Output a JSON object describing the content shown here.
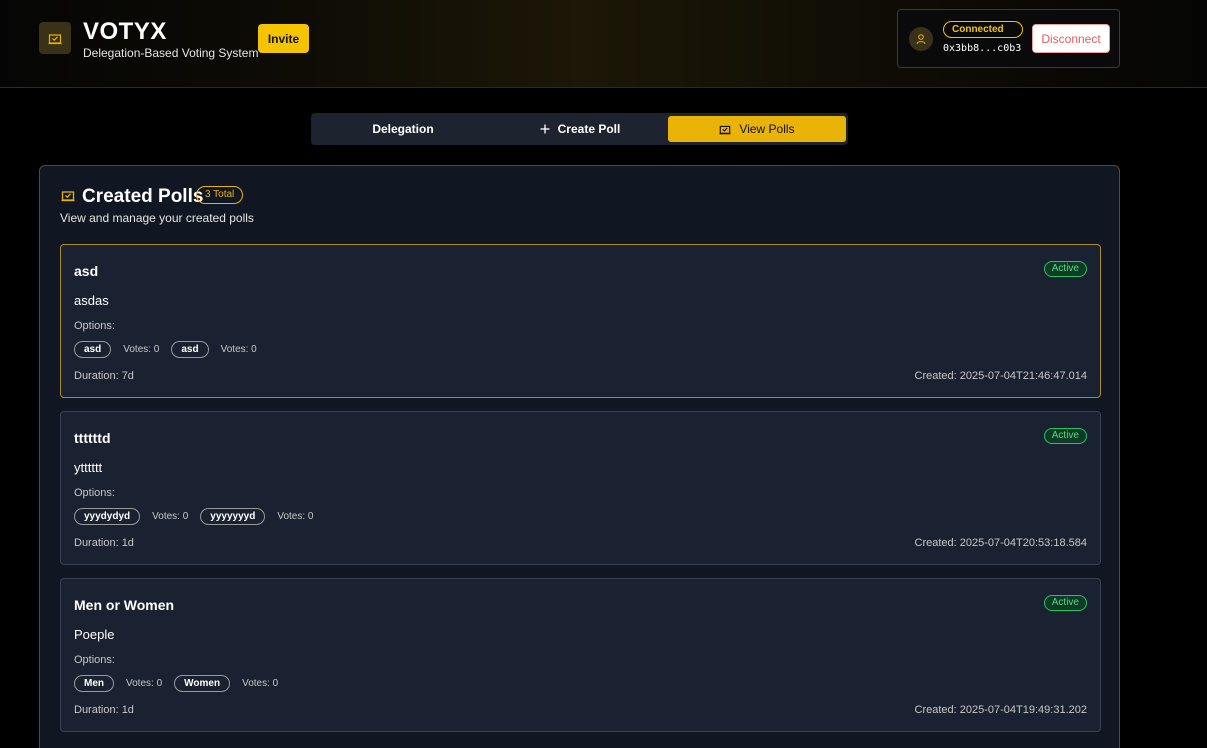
{
  "header": {
    "title": "VOTYX",
    "subtitle": "Delegation-Based Voting System",
    "invite_label": "Invite",
    "logo_icon": "ballot-box-icon"
  },
  "wallet": {
    "status": "Connected",
    "address": "0x3bb8...c0b3",
    "disconnect_label": "Disconnect",
    "avatar_icon": "user-icon"
  },
  "tabs": [
    {
      "label": "Delegation",
      "active": false
    },
    {
      "label": "Create Poll",
      "icon": "plus-icon",
      "active": false
    },
    {
      "label": "View Polls",
      "icon": "ballot-box-icon",
      "active": true
    }
  ],
  "panel": {
    "title": "Created Polls",
    "total_badge": "3 Total",
    "subtitle": "View and manage your created polls"
  },
  "polls": [
    {
      "title": "asd",
      "status": "Active",
      "description": "asdas",
      "options_label": "Options:",
      "options": [
        {
          "label": "asd",
          "votes": "Votes: 0"
        },
        {
          "label": "asd",
          "votes": "Votes: 0"
        }
      ],
      "duration": "Duration: 7d",
      "created": "Created: 2025-07-04T21:46:47.014"
    },
    {
      "title": "ttttttd",
      "status": "Active",
      "description": "ytttttt",
      "options_label": "Options:",
      "options": [
        {
          "label": "yyydydyd",
          "votes": "Votes: 0"
        },
        {
          "label": "yyyyyyyd",
          "votes": "Votes: 0"
        }
      ],
      "duration": "Duration: 1d",
      "created": "Created: 2025-07-04T20:53:18.584"
    },
    {
      "title": "Men or Women",
      "status": "Active",
      "description": "Poeple",
      "options_label": "Options:",
      "options": [
        {
          "label": "Men",
          "votes": "Votes: 0"
        },
        {
          "label": "Women",
          "votes": "Votes: 0"
        }
      ],
      "duration": "Duration: 1d",
      "created": "Created: 2025-07-04T19:49:31.202"
    }
  ]
}
